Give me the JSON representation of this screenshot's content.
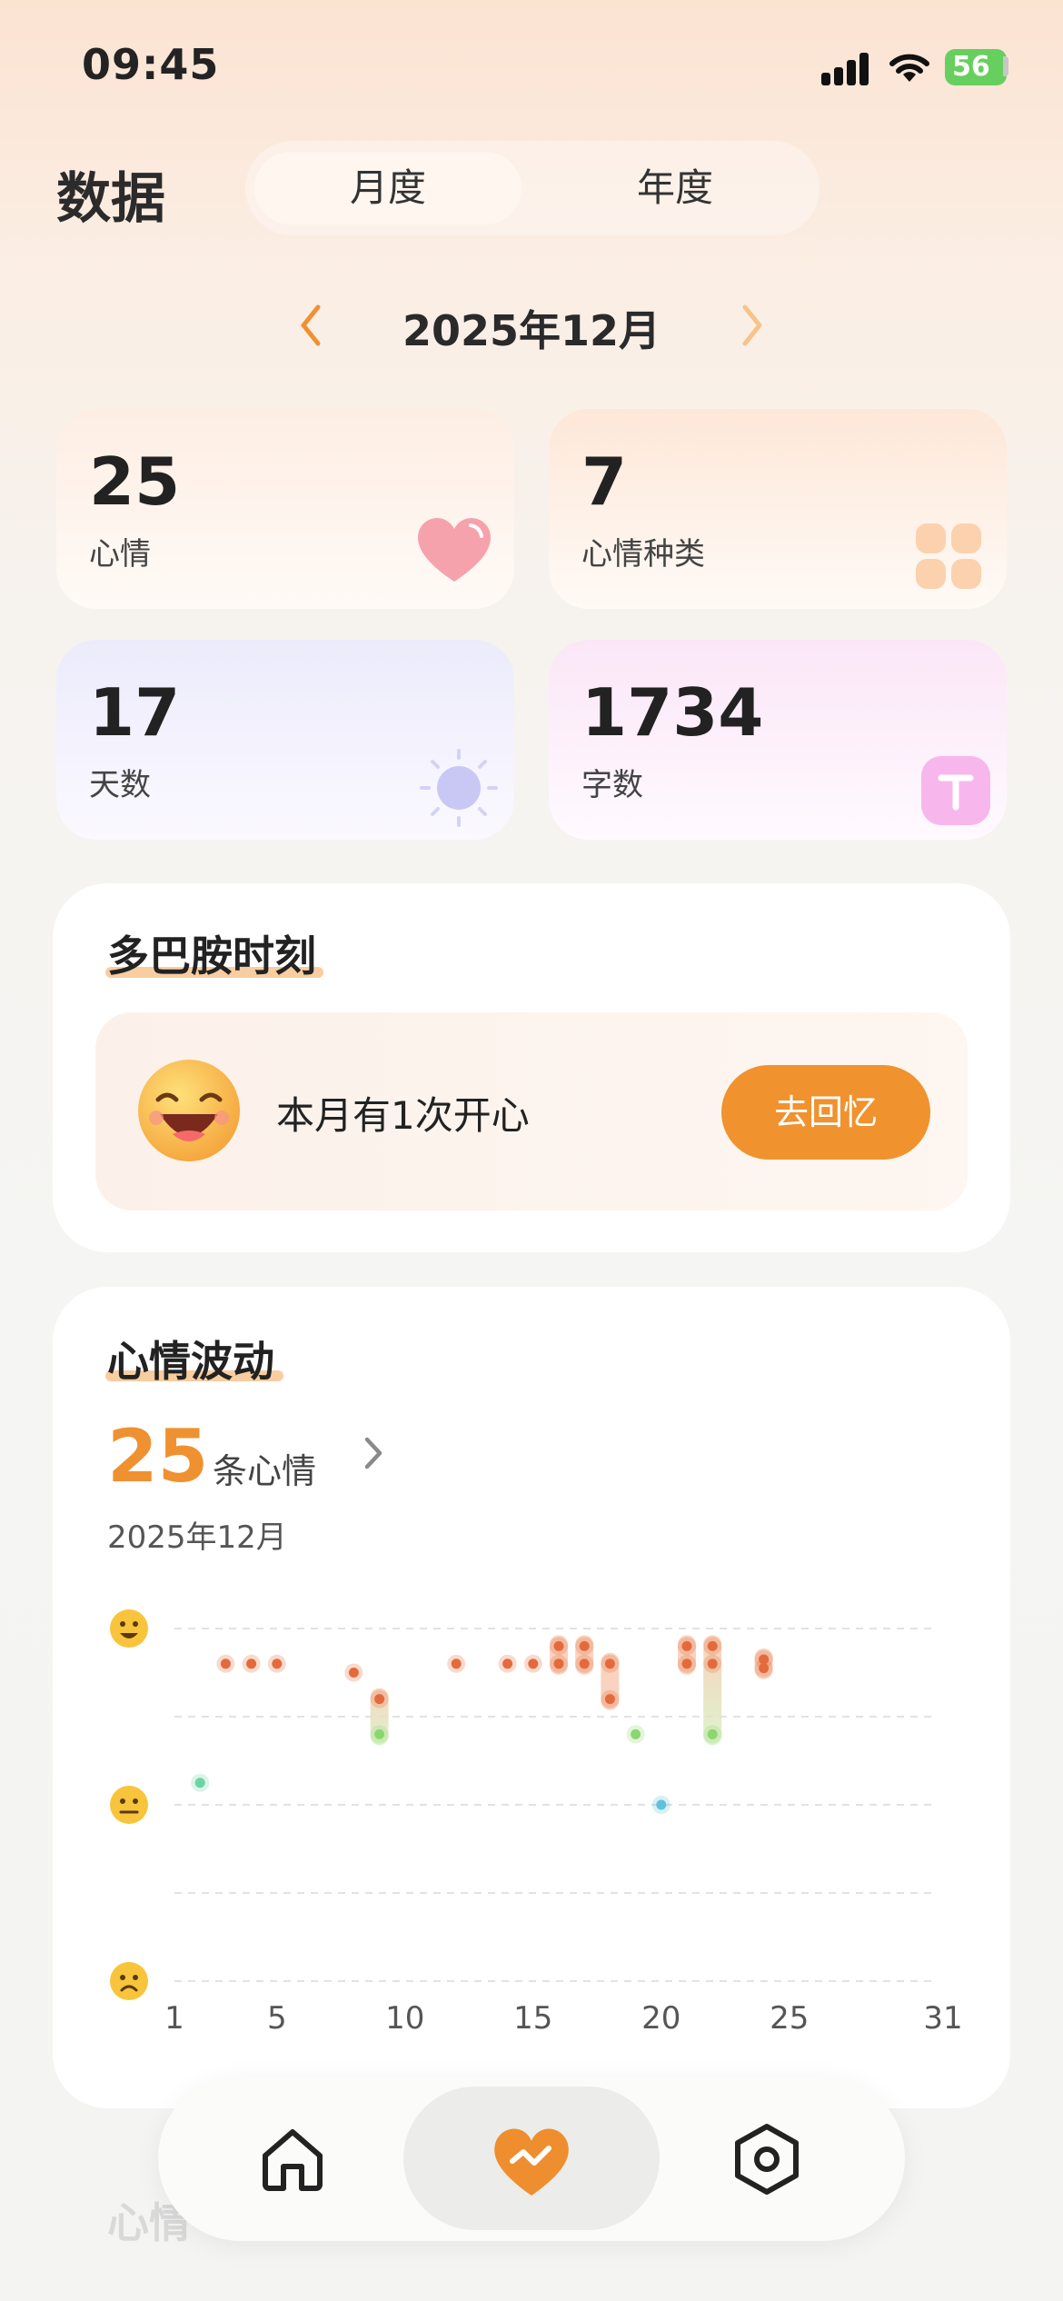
{
  "status_bar": {
    "time": "09:45",
    "battery": "56"
  },
  "header": {
    "title": "数据",
    "tabs": [
      {
        "label": "月度",
        "active": true
      },
      {
        "label": "年度",
        "active": false
      }
    ]
  },
  "month_nav": {
    "label": "2025年12月"
  },
  "stats": [
    {
      "value": "25",
      "label": "心情",
      "icon": "heart-icon"
    },
    {
      "value": "7",
      "label": "心情种类",
      "icon": "grid-icon"
    },
    {
      "value": "17",
      "label": "天数",
      "icon": "sun-icon"
    },
    {
      "value": "1734",
      "label": "字数",
      "icon": "text-icon"
    }
  ],
  "dopamine": {
    "title": "多巴胺时刻",
    "text": "本月有1次开心",
    "button": "去回忆"
  },
  "mood_wave": {
    "title": "心情波动",
    "count": "25",
    "unit": "条心情",
    "month": "2025年12月"
  },
  "chart_data": {
    "type": "scatter",
    "title": "",
    "xlabel": "",
    "ylabel": "",
    "xlim": [
      1,
      31
    ],
    "xticks": [
      "1",
      "5",
      "10",
      "15",
      "20",
      "25",
      "31"
    ],
    "ylim": [
      0,
      4
    ],
    "y_axis_icons": [
      "happy-face-icon",
      "neutral-face-icon",
      "sad-face-icon"
    ],
    "colors": {
      "good": "#e46a3c",
      "calm": "#8bd66f",
      "neutral_green": "#6dd3a3",
      "neutral_blue": "#5ec2dd"
    },
    "points": [
      {
        "day": 2,
        "mood": 2.25,
        "color": "#6dd3a3"
      },
      {
        "day": 3,
        "mood": 3.6,
        "color": "#e46a3c"
      },
      {
        "day": 4,
        "mood": 3.6,
        "color": "#e46a3c"
      },
      {
        "day": 5,
        "mood": 3.6,
        "color": "#e46a3c"
      },
      {
        "day": 8,
        "mood": 3.5,
        "color": "#e46a3c"
      },
      {
        "day": 9,
        "mood": 3.2,
        "color": "#e46a3c"
      },
      {
        "day": 9,
        "mood": 2.8,
        "color": "#8bd66f"
      },
      {
        "day": 12,
        "mood": 3.6,
        "color": "#e46a3c"
      },
      {
        "day": 14,
        "mood": 3.6,
        "color": "#e46a3c"
      },
      {
        "day": 15,
        "mood": 3.6,
        "color": "#e46a3c"
      },
      {
        "day": 16,
        "mood": 3.8,
        "color": "#e46a3c"
      },
      {
        "day": 16,
        "mood": 3.6,
        "color": "#e46a3c"
      },
      {
        "day": 17,
        "mood": 3.8,
        "color": "#e46a3c"
      },
      {
        "day": 17,
        "mood": 3.6,
        "color": "#e46a3c"
      },
      {
        "day": 18,
        "mood": 3.6,
        "color": "#e46a3c"
      },
      {
        "day": 18,
        "mood": 3.2,
        "color": "#e46a3c"
      },
      {
        "day": 19,
        "mood": 2.8,
        "color": "#8bd66f"
      },
      {
        "day": 20,
        "mood": 2.0,
        "color": "#5ec2dd"
      },
      {
        "day": 21,
        "mood": 3.8,
        "color": "#e46a3c"
      },
      {
        "day": 21,
        "mood": 3.6,
        "color": "#e46a3c"
      },
      {
        "day": 22,
        "mood": 3.8,
        "color": "#e46a3c"
      },
      {
        "day": 22,
        "mood": 3.6,
        "color": "#e46a3c"
      },
      {
        "day": 22,
        "mood": 2.8,
        "color": "#8bd66f"
      },
      {
        "day": 24,
        "mood": 3.65,
        "color": "#e46a3c"
      },
      {
        "day": 24,
        "mood": 3.55,
        "color": "#e46a3c"
      }
    ],
    "ranges": [
      {
        "day": 9,
        "from": 2.8,
        "to": 3.2
      },
      {
        "day": 16,
        "from": 3.6,
        "to": 3.8
      },
      {
        "day": 17,
        "from": 3.6,
        "to": 3.8
      },
      {
        "day": 18,
        "from": 3.2,
        "to": 3.6
      },
      {
        "day": 21,
        "from": 3.6,
        "to": 3.8
      },
      {
        "day": 22,
        "from": 2.8,
        "to": 3.8
      },
      {
        "day": 24,
        "from": 3.55,
        "to": 3.65
      }
    ]
  },
  "tabbar": {
    "items": [
      {
        "icon": "home-icon"
      },
      {
        "icon": "heart-chart-icon",
        "active": true
      },
      {
        "icon": "settings-icon"
      }
    ]
  },
  "next_section": {
    "title": "心情"
  }
}
